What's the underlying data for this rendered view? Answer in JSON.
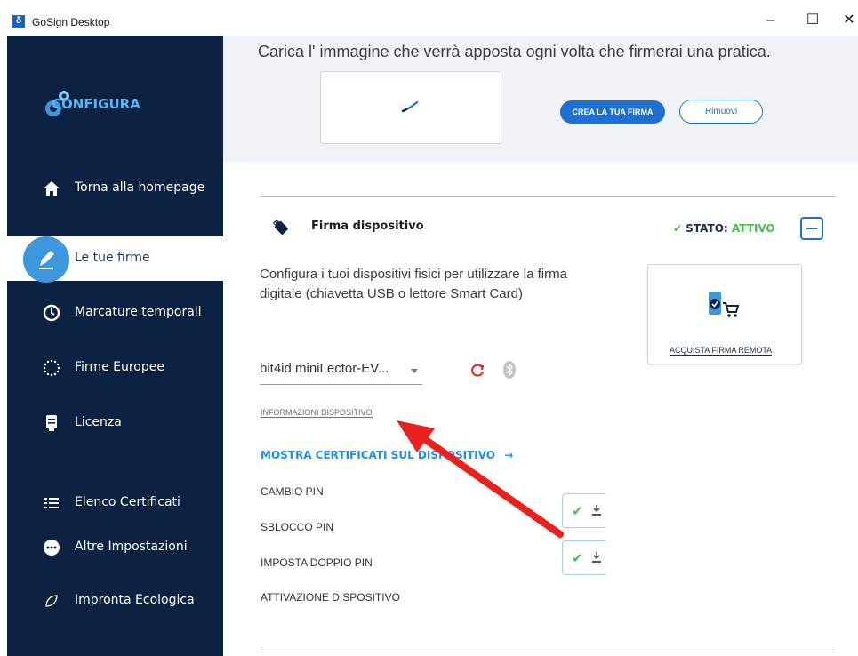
{
  "window": {
    "title": "GoSign Desktop",
    "minimize_label": "–",
    "maximize_label": "☐",
    "close_label": "✕"
  },
  "sidebar": {
    "brand_label": "CONFIGURA",
    "items": [
      {
        "label": "Torna alla homepage",
        "icon": "home-icon"
      },
      {
        "label": "Le tue firme",
        "icon": "signature-icon",
        "active": true
      },
      {
        "label": "Marcature temporali",
        "icon": "clock-icon"
      },
      {
        "label": "Firme Europee",
        "icon": "eu-stars-icon"
      },
      {
        "label": "Licenza",
        "icon": "license-icon"
      },
      {
        "label": "Elenco Certificati",
        "icon": "list-icon"
      },
      {
        "label": "Altre Impostazioni",
        "icon": "more-icon"
      },
      {
        "label": "Impronta Ecologica",
        "icon": "leaf-icon"
      }
    ],
    "background": "#0c2242",
    "accent": "#3c97dd"
  },
  "signature_image": {
    "upload_text": "Carica l' immagine che verrà apposta ogni volta che firmerai una pratica.",
    "create_button": "CREA LA TUA FIRMA",
    "remove_button": "Rimuovi"
  },
  "device_signature": {
    "title": "Firma dispositivo",
    "status_prefix": "STATO:",
    "status_value": "ATTIVO",
    "status_color": "#4dbe4d",
    "description": "Configura i tuoi dispositivi fisici per utilizzare la firma digitale (chiavetta USB o lettore Smart Card)",
    "buy_remote_label": "ACQUISTA FIRMA REMOTA",
    "device_selected": "bit4id miniLector-EV...",
    "info_link": "INFORMAZIONI DISPOSITIVO",
    "certificates_link": "MOSTRA CERTIFICATI SUL DISPOSITIVO",
    "actions": [
      {
        "label": "CAMBIO PIN"
      },
      {
        "label": "SBLOCCO PIN"
      },
      {
        "label": "IMPOSTA DOPPIO PIN"
      },
      {
        "label": "ATTIVAZIONE DISPOSITIVO"
      }
    ]
  },
  "annotation": {
    "arrow_color": "#e8211c"
  }
}
